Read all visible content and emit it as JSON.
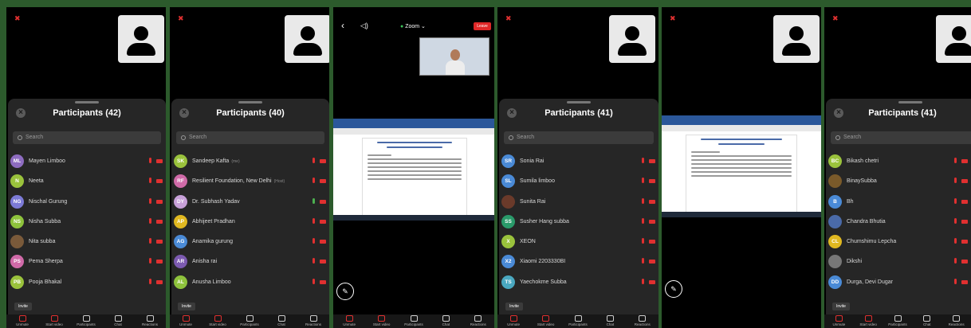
{
  "panels": [
    {
      "title": "Participants (42)",
      "search_placeholder": "Search",
      "invite": "Invite",
      "participants": [
        {
          "initials": "ML",
          "name": "Mayen Limboo",
          "color": "#8e6cc0",
          "mic": "off"
        },
        {
          "initials": "N",
          "name": "Neeta",
          "color": "#9ac23c",
          "mic": "off"
        },
        {
          "initials": "NG",
          "name": "Nischal Gurung",
          "color": "#7c7ad6",
          "mic": "off"
        },
        {
          "initials": "NS",
          "name": "Nisha Subba",
          "color": "#8ec23c",
          "mic": "off"
        },
        {
          "initials": "",
          "name": "Nita subba",
          "color": "#7a5a3a",
          "mic": "off"
        },
        {
          "initials": "PS",
          "name": "Pema Sherpa",
          "color": "#d06aa8",
          "mic": "off"
        },
        {
          "initials": "PB",
          "name": "Pooja Bhakal",
          "color": "#9ac23c",
          "mic": "off"
        }
      ]
    },
    {
      "title": "Participants (40)",
      "search_placeholder": "Search",
      "invite": "Invite",
      "participants": [
        {
          "initials": "SK",
          "name": "Sandeep Kafta",
          "tag": "(me)",
          "color": "#9ac23c",
          "mic": "off"
        },
        {
          "initials": "RF",
          "name": "Resilient Foundation, New Delhi",
          "tag": "(Host)",
          "color": "#d06aa8",
          "mic": "off"
        },
        {
          "initials": "DY",
          "name": "Dr. Subhash Yadav",
          "color": "#c7a0d8",
          "mic": "on"
        },
        {
          "initials": "AP",
          "name": "Abhijeet Pradhan",
          "color": "#e0b820",
          "mic": "off"
        },
        {
          "initials": "AG",
          "name": "Anamika gurung",
          "color": "#4a8ad6",
          "mic": "off"
        },
        {
          "initials": "AR",
          "name": "Anisha rai",
          "color": "#7c5ab0",
          "mic": "off"
        },
        {
          "initials": "AL",
          "name": "Anusha Limboo",
          "color": "#8ec23c",
          "mic": "off"
        }
      ]
    },
    {
      "title": "Participants (41)",
      "search_placeholder": "Search",
      "invite": "Invite",
      "participants": [
        {
          "initials": "SR",
          "name": "Sonia Rai",
          "color": "#4a8ad6",
          "mic": "off"
        },
        {
          "initials": "SL",
          "name": "Sumila limboo",
          "color": "#4a8ad6",
          "mic": "off"
        },
        {
          "initials": "",
          "name": "Sunita Rai",
          "color": "#6a3a2a",
          "mic": "off"
        },
        {
          "initials": "SS",
          "name": "Susher Hang subba",
          "color": "#2a9a6a",
          "mic": "off"
        },
        {
          "initials": "X",
          "name": "XEON",
          "color": "#9ac23c",
          "mic": "off"
        },
        {
          "initials": "X2",
          "name": "Xiaomi 2203330BI",
          "color": "#4a8ad6",
          "mic": "off"
        },
        {
          "initials": "TS",
          "name": "Yaechokme Subba",
          "color": "#4aa8c0",
          "mic": "off"
        }
      ]
    },
    {
      "title": "Participants (41)",
      "search_placeholder": "Search",
      "invite": "Invite",
      "participants": [
        {
          "initials": "BC",
          "name": "Bikash chetri",
          "color": "#9ac23c",
          "mic": "off"
        },
        {
          "initials": "",
          "name": "BinaySubba",
          "color": "#7a5a2a",
          "mic": "off"
        },
        {
          "initials": "B",
          "name": "Bh",
          "color": "#4a8ad6",
          "mic": "off"
        },
        {
          "initials": "",
          "name": "Chandra Bhutia",
          "color": "#4a6aa8",
          "mic": "off"
        },
        {
          "initials": "CL",
          "name": "Chumshimu Lepcha",
          "color": "#e0b820",
          "mic": "off"
        },
        {
          "initials": "",
          "name": "Dikshi",
          "color": "#777777",
          "mic": "off"
        },
        {
          "initials": "DD",
          "name": "Durga, Devi Dugar",
          "color": "#4a8ad6",
          "mic": "off"
        }
      ]
    }
  ],
  "toolbar": {
    "items": [
      {
        "icon": "mic-icon",
        "label": "Unmute"
      },
      {
        "icon": "video-off-icon",
        "label": "Start video"
      },
      {
        "icon": "participants-icon",
        "label": "Participants"
      },
      {
        "icon": "chat-icon",
        "label": "Chat"
      },
      {
        "icon": "reactions-icon",
        "label": "Reactions"
      }
    ]
  },
  "meeting_view": {
    "app_label": "Zoom",
    "leave_label": "Leave"
  },
  "colors": {
    "mic_off": "#e03030",
    "mic_on": "#4caf50",
    "leave": "#e02828",
    "sheet": "#262626"
  }
}
